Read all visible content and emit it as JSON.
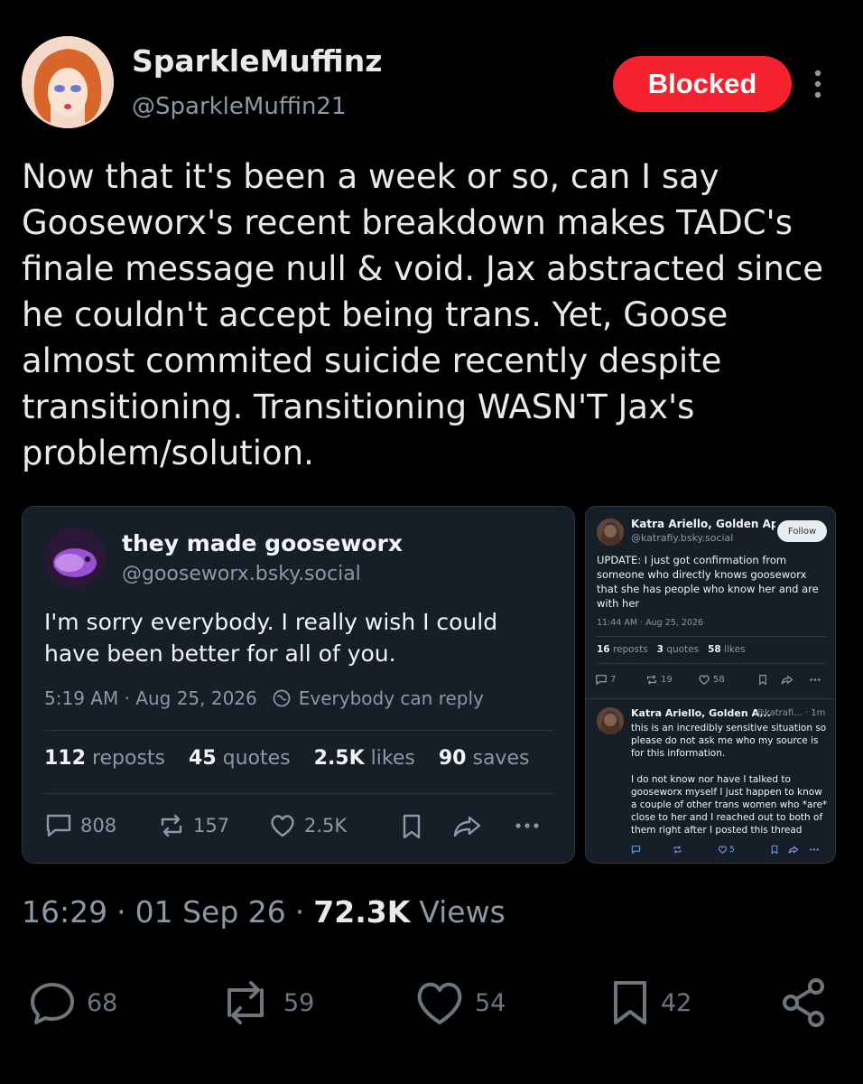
{
  "user": {
    "name": "SparkleMuffinz",
    "handle": "@SparkleMuffin21",
    "blocked_label": "Blocked"
  },
  "tweet": {
    "text": "Now that it's been a week or so, can I say Gooseworx's recent breakdown makes TADC's finale message null & void. Jax abstracted since he couldn't accept being trans. Yet, Goose almost commited suicide recently despite transitioning. Transitioning WASN'T Jax's problem/solution."
  },
  "embed_left": {
    "name": "they made gooseworx",
    "handle": "@gooseworx.bsky.social",
    "text": "I'm sorry everybody. I really wish I could have been better for all of you.",
    "time": "5:19 AM · Aug 25, 2026",
    "reply_setting": "Everybody can reply",
    "stats": [
      {
        "num": "112",
        "label": "reposts"
      },
      {
        "num": "45",
        "label": "quotes"
      },
      {
        "num": "2.5K",
        "label": "likes"
      },
      {
        "num": "90",
        "label": "saves"
      }
    ],
    "actions": {
      "replies": "808",
      "reposts": "157",
      "likes": "2.5K"
    }
  },
  "embed_right": {
    "post1": {
      "name": "Katra Ariello, Golden Apple A...",
      "handle": "@katrafiy.bsky.social",
      "follow_label": "Follow",
      "text": "UPDATE: I just got confirmation from someone who directly knows gooseworx that she has people who know her and are with her",
      "time": "11:44 AM · Aug 25, 2026",
      "stats": [
        {
          "num": "16",
          "label": "reposts"
        },
        {
          "num": "3",
          "label": "quotes"
        },
        {
          "num": "58",
          "label": "likes"
        }
      ],
      "actions": {
        "replies": "7",
        "reposts": "19",
        "likes": "58"
      }
    },
    "post2": {
      "name": "Katra Ariello, Golden A...",
      "meta": "@katrafi... · 1m",
      "text1": "this is an incredibly sensitive situation so please do not ask me who my source is for this information.",
      "text2": "I do not know nor have I talked to gooseworx myself I just happen to know a couple of other trans women who *are* close to her and I reached out to both of them right after I posted this thread",
      "actions": {
        "likes": "5"
      }
    }
  },
  "footer": {
    "time": "16:29",
    "date": "01 Sep 26",
    "views_count": "72.3K",
    "views_label": "Views",
    "sep": "·"
  },
  "actionbar": {
    "replies": "68",
    "reposts": "59",
    "likes": "54",
    "bookmarks": "42"
  },
  "colors": {
    "background": "#000000",
    "blocked": "#f4212e",
    "card": "#161e27",
    "muted": "#8b98a5"
  }
}
